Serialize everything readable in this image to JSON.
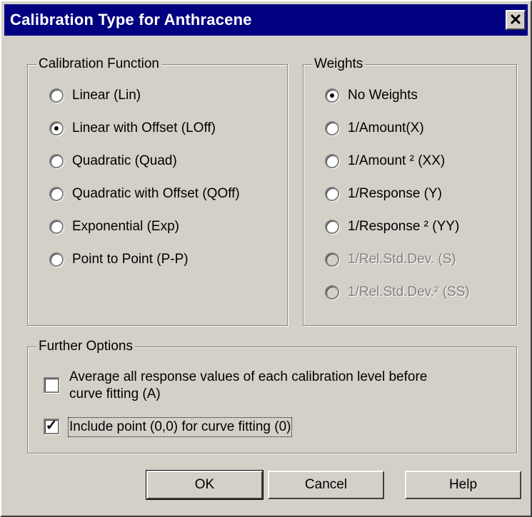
{
  "window": {
    "title": "Calibration Type for Anthracene",
    "close_glyph": "✕"
  },
  "calibration_function": {
    "title": "Calibration Function",
    "options": [
      {
        "label": "Linear (Lin)",
        "selected": false,
        "enabled": true
      },
      {
        "label": "Linear with Offset (LOff)",
        "selected": true,
        "enabled": true
      },
      {
        "label": "Quadratic (Quad)",
        "selected": false,
        "enabled": true
      },
      {
        "label": "Quadratic with Offset (QOff)",
        "selected": false,
        "enabled": true
      },
      {
        "label": "Exponential (Exp)",
        "selected": false,
        "enabled": true
      },
      {
        "label": "Point to Point (P-P)",
        "selected": false,
        "enabled": true
      }
    ]
  },
  "weights": {
    "title": "Weights",
    "options": [
      {
        "label": "No Weights",
        "selected": true,
        "enabled": true
      },
      {
        "label": "1/Amount(X)",
        "selected": false,
        "enabled": true
      },
      {
        "label": "1/Amount ² (XX)",
        "selected": false,
        "enabled": true
      },
      {
        "label": "1/Response (Y)",
        "selected": false,
        "enabled": true
      },
      {
        "label": "1/Response ² (YY)",
        "selected": false,
        "enabled": true
      },
      {
        "label": "1/Rel.Std.Dev. (S)",
        "selected": false,
        "enabled": false
      },
      {
        "label": "1/Rel.Std.Dev.² (SS)",
        "selected": false,
        "enabled": false
      }
    ]
  },
  "further_options": {
    "title": "Further Options",
    "average": {
      "line1": "Average all response values of each calibration level before",
      "line2": "curve fitting (A)",
      "checked": false
    },
    "include_zero": {
      "label": "Include point (0,0) for curve fitting (0)",
      "checked": true,
      "check_glyph": "✓"
    }
  },
  "buttons": {
    "ok": "OK",
    "cancel": "Cancel",
    "help": "Help"
  },
  "colors": {
    "face": "#d4d0c8",
    "titlebar": "#000080"
  }
}
